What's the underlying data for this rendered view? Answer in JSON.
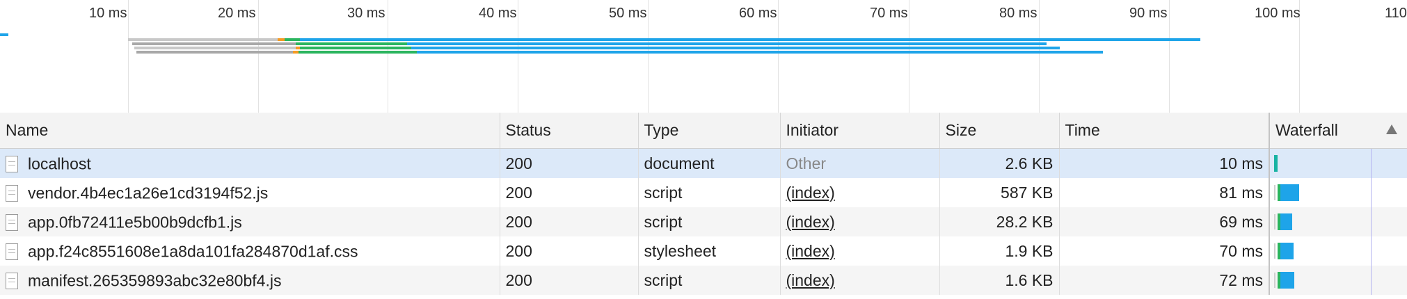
{
  "overview": {
    "ticks": [
      "10 ms",
      "20 ms",
      "30 ms",
      "40 ms",
      "50 ms",
      "60 ms",
      "70 ms",
      "80 ms",
      "90 ms",
      "100 ms",
      "110"
    ]
  },
  "table": {
    "headers": {
      "name": "Name",
      "status": "Status",
      "type": "Type",
      "initiator": "Initiator",
      "size": "Size",
      "time": "Time",
      "waterfall": "Waterfall"
    },
    "rows": [
      {
        "name": "localhost",
        "status": "200",
        "type": "document",
        "initiator": "Other",
        "size": "2.6 KB",
        "time": "10 ms"
      },
      {
        "name": "vendor.4b4ec1a26e1cd3194f52.js",
        "status": "200",
        "type": "script",
        "initiator": "(index)",
        "size": "587 KB",
        "time": "81 ms"
      },
      {
        "name": "app.0fb72411e5b00b9dcfb1.js",
        "status": "200",
        "type": "script",
        "initiator": "(index)",
        "size": "28.2 KB",
        "time": "69 ms"
      },
      {
        "name": "app.f24c8551608e1a8da101fa284870d1af.css",
        "status": "200",
        "type": "stylesheet",
        "initiator": "(index)",
        "size": "1.9 KB",
        "time": "70 ms"
      },
      {
        "name": "manifest.265359893abc32e80bf4.js",
        "status": "200",
        "type": "script",
        "initiator": "(index)",
        "size": "1.6 KB",
        "time": "72 ms"
      }
    ]
  },
  "colors": {
    "receiving": "#1ea4e9",
    "waiting": "#2bb55f",
    "stalled": "#a0a0a0",
    "ssl": "#f59a23",
    "selected_row": "#dce9f9"
  }
}
